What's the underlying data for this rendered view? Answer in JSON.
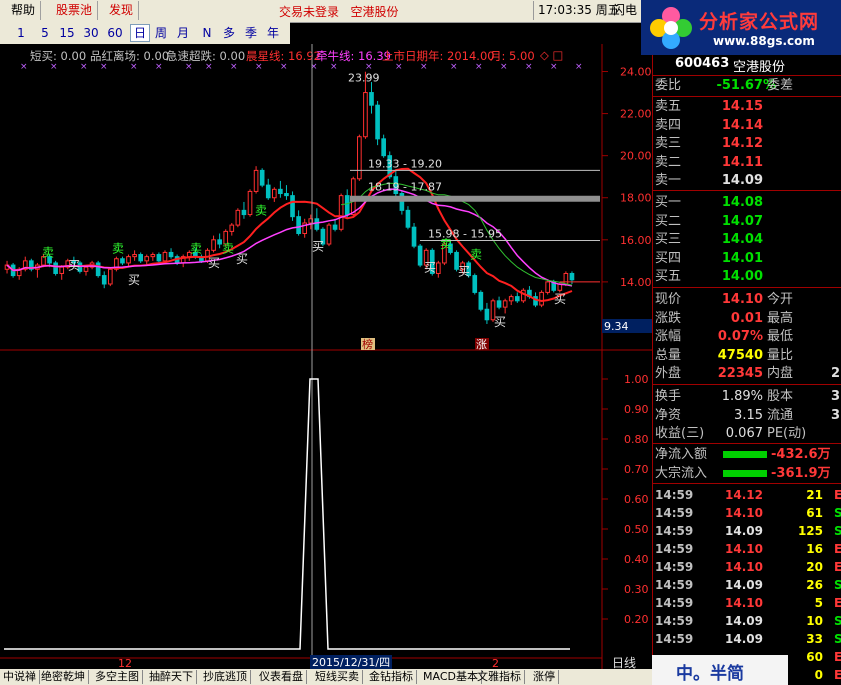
{
  "menu": {
    "help": "帮助",
    "pool": "股票池",
    "spot": "发现",
    "status": "交易未登录",
    "stock_name_top": "空港股份",
    "clock": "17:03:35",
    "weekday": "周五",
    "flash": "闪电"
  },
  "logo": {
    "title": "分析家公式网",
    "url": "www.88gs.com"
  },
  "periods": [
    "1",
    "5",
    "15",
    "30",
    "60",
    "日",
    "周",
    "月",
    "N",
    "多",
    "季",
    "年"
  ],
  "selected_period": "日",
  "legend": [
    {
      "text": "短买: 0.00",
      "color": "#c0c0c0"
    },
    {
      "text": "品红离场: 0.00",
      "color": "#c0c0c0"
    },
    {
      "text": "急速超跌: 0.00",
      "color": "#c0c0c0"
    },
    {
      "text": "晨星线: 16.92",
      "color": "#ff3030"
    },
    {
      "text": "牵牛线: 16.39",
      "color": "#ff40ff"
    },
    {
      "text": "上市日期年: 2014.00",
      "color": "#ff3030"
    },
    {
      "text": "月: 5.00",
      "color": "#ff3030"
    },
    {
      "text": "◇ □",
      "color": "#ff3030"
    }
  ],
  "price_axis": [
    "24.00",
    "22.00",
    "20.00",
    "18.00",
    "16.00",
    "14.00",
    "12.00"
  ],
  "price_axis_extra": "9.34",
  "indicator_axis": [
    "1.00",
    "0.90",
    "0.80",
    "0.70",
    "0.60",
    "0.50",
    "0.40",
    "0.30",
    "0.20"
  ],
  "annotations": {
    "high": "23.99",
    "range1": "19.33 - 19.20",
    "range2": "18.19 - 17.87",
    "range3": "15.98 - 15.95",
    "sell": "卖",
    "buy": "买",
    "tag_bang": "榜",
    "tag_zhang": "涨"
  },
  "time_axis": {
    "left": "12",
    "cursor": "2015/12/31/四",
    "right": "2",
    "mode": "日线"
  },
  "quote": {
    "code": "600463",
    "name": "空港股份",
    "webi_label": "委比",
    "webi": "-51.67%",
    "weicha_label": "委差",
    "asks": [
      {
        "label": "卖五",
        "price": "14.15"
      },
      {
        "label": "卖四",
        "price": "14.14"
      },
      {
        "label": "卖三",
        "price": "14.12"
      },
      {
        "label": "卖二",
        "price": "14.11"
      },
      {
        "label": "卖一",
        "price": "14.09"
      }
    ],
    "bids": [
      {
        "label": "买一",
        "price": "14.08"
      },
      {
        "label": "买二",
        "price": "14.07"
      },
      {
        "label": "买三",
        "price": "14.04"
      },
      {
        "label": "买四",
        "price": "14.01"
      },
      {
        "label": "买五",
        "price": "14.00"
      }
    ],
    "stats": [
      {
        "label": "现价",
        "value": "14.10",
        "color": "red",
        "label2": "今开"
      },
      {
        "label": "涨跌",
        "value": "0.01",
        "color": "red",
        "label2": "最高"
      },
      {
        "label": "涨幅",
        "value": "0.07%",
        "color": "red",
        "label2": "最低"
      },
      {
        "label": "总量",
        "value": "47540",
        "color": "yel",
        "label2": "量比"
      },
      {
        "label": "外盘",
        "value": "22345",
        "color": "red",
        "label2": "内盘",
        "extra": "2"
      }
    ],
    "stats2": [
      {
        "label": "换手",
        "value": "1.89%",
        "label2": "股本",
        "extra": "3"
      },
      {
        "label": "净资",
        "value": "3.15",
        "label2": "流通",
        "extra": "3"
      },
      {
        "label": "收益(三)",
        "value": "0.067",
        "label2": "PE(动)",
        "extra": ""
      }
    ],
    "flows": [
      {
        "label": "净流入额",
        "value": "-432.6万"
      },
      {
        "label": "大宗流入",
        "value": "-361.9万"
      }
    ],
    "ticks": [
      {
        "time": "14:59",
        "price": "14.12",
        "color": "red",
        "vol": "21",
        "side": "E"
      },
      {
        "time": "14:59",
        "price": "14.10",
        "color": "red",
        "vol": "61",
        "side": "S"
      },
      {
        "time": "14:59",
        "price": "14.09",
        "color": "wht",
        "vol": "125",
        "side": "S"
      },
      {
        "time": "14:59",
        "price": "14.10",
        "color": "red",
        "vol": "16",
        "side": "E"
      },
      {
        "time": "14:59",
        "price": "14.10",
        "color": "red",
        "vol": "20",
        "side": "E"
      },
      {
        "time": "14:59",
        "price": "14.09",
        "color": "wht",
        "vol": "26",
        "side": "S"
      },
      {
        "time": "14:59",
        "price": "14.10",
        "color": "red",
        "vol": "5",
        "side": "E"
      },
      {
        "time": "14:59",
        "price": "14.09",
        "color": "wht",
        "vol": "10",
        "side": "S"
      },
      {
        "time": "14:59",
        "price": "14.09",
        "color": "wht",
        "vol": "33",
        "side": "S"
      },
      {
        "time": "",
        "price": "",
        "color": "wht",
        "vol": "60",
        "side": "E"
      },
      {
        "time": "",
        "price": "",
        "color": "wht",
        "vol": "0",
        "side": "E"
      }
    ]
  },
  "bottom_tabs": [
    "中说禅",
    "绝密乾坤",
    "多空主图",
    "抽醉天下",
    "抄底逃顶",
    "仪表看盘",
    "短线买卖",
    "金钻指标",
    "MACD基本",
    "文雅指标",
    "涨停"
  ],
  "bottom_right": {
    "text": "中。半简"
  },
  "chart_data": {
    "type": "candlestick",
    "price_axis_range": [
      11.0,
      24.5
    ],
    "candles": [
      [
        14.6,
        15.0,
        14.4,
        14.8
      ],
      [
        14.8,
        14.9,
        14.2,
        14.3
      ],
      [
        14.3,
        14.7,
        14.1,
        14.6
      ],
      [
        14.6,
        15.2,
        14.5,
        15.0
      ],
      [
        15.0,
        15.1,
        14.5,
        14.6
      ],
      [
        14.6,
        14.9,
        14.2,
        14.8
      ],
      [
        14.8,
        15.3,
        14.7,
        15.2
      ],
      [
        15.2,
        15.3,
        14.7,
        14.9
      ],
      [
        14.9,
        15.0,
        14.3,
        14.4
      ],
      [
        14.4,
        14.8,
        14.1,
        14.7
      ],
      [
        14.7,
        15.1,
        14.6,
        15.0
      ],
      [
        15.0,
        15.2,
        14.8,
        14.9
      ],
      [
        14.9,
        15.0,
        14.4,
        14.5
      ],
      [
        14.5,
        14.8,
        14.3,
        14.7
      ],
      [
        14.7,
        15.0,
        14.6,
        14.9
      ],
      [
        14.9,
        15.0,
        14.2,
        14.3
      ],
      [
        14.3,
        14.5,
        13.7,
        13.9
      ],
      [
        13.9,
        14.7,
        13.8,
        14.6
      ],
      [
        14.6,
        15.2,
        14.5,
        15.1
      ],
      [
        15.1,
        15.2,
        14.8,
        14.9
      ],
      [
        14.9,
        15.3,
        14.7,
        15.2
      ],
      [
        15.2,
        15.5,
        15.0,
        15.3
      ],
      [
        15.3,
        15.4,
        14.9,
        15.0
      ],
      [
        15.0,
        15.3,
        14.8,
        15.2
      ],
      [
        15.2,
        15.4,
        15.0,
        15.3
      ],
      [
        15.3,
        15.4,
        14.9,
        15.0
      ],
      [
        15.0,
        15.5,
        14.9,
        15.4
      ],
      [
        15.4,
        15.6,
        15.1,
        15.2
      ],
      [
        15.2,
        15.3,
        14.8,
        14.9
      ],
      [
        14.9,
        15.3,
        14.7,
        15.2
      ],
      [
        15.2,
        15.5,
        15.0,
        15.4
      ],
      [
        15.4,
        15.6,
        15.1,
        15.2
      ],
      [
        15.2,
        15.3,
        14.9,
        15.0
      ],
      [
        15.0,
        15.6,
        14.9,
        15.5
      ],
      [
        15.5,
        16.2,
        15.4,
        16.0
      ],
      [
        16.0,
        16.3,
        15.6,
        15.8
      ],
      [
        15.8,
        16.5,
        15.7,
        16.4
      ],
      [
        16.4,
        16.8,
        16.2,
        16.7
      ],
      [
        16.7,
        17.5,
        16.6,
        17.4
      ],
      [
        17.4,
        17.8,
        17.0,
        17.2
      ],
      [
        17.2,
        18.4,
        17.1,
        18.3
      ],
      [
        18.3,
        19.5,
        18.2,
        19.3
      ],
      [
        19.3,
        19.4,
        18.5,
        18.6
      ],
      [
        18.6,
        18.9,
        17.9,
        18.0
      ],
      [
        18.0,
        18.5,
        17.8,
        18.4
      ],
      [
        18.4,
        18.8,
        18.0,
        18.2
      ],
      [
        18.2,
        18.6,
        17.9,
        18.1
      ],
      [
        18.1,
        18.3,
        16.9,
        17.1
      ],
      [
        17.1,
        17.4,
        16.2,
        16.3
      ],
      [
        16.3,
        17.0,
        16.1,
        16.8
      ],
      [
        16.8,
        17.2,
        16.5,
        17.0
      ],
      [
        17.0,
        17.5,
        16.4,
        16.5
      ],
      [
        16.5,
        16.6,
        15.7,
        15.8
      ],
      [
        15.8,
        16.8,
        15.7,
        16.7
      ],
      [
        16.7,
        17.0,
        16.4,
        16.5
      ],
      [
        16.5,
        18.2,
        16.4,
        18.1
      ],
      [
        18.1,
        18.4,
        17.0,
        17.2
      ],
      [
        17.2,
        19.0,
        17.1,
        18.9
      ],
      [
        18.9,
        21.0,
        18.8,
        20.9
      ],
      [
        20.9,
        23.99,
        20.8,
        23.0
      ],
      [
        23.0,
        23.5,
        22.0,
        22.4
      ],
      [
        22.4,
        22.6,
        20.5,
        20.8
      ],
      [
        20.8,
        21.0,
        19.9,
        20.0
      ],
      [
        20.0,
        20.2,
        18.9,
        19.0
      ],
      [
        19.0,
        19.3,
        17.9,
        18.2
      ],
      [
        18.2,
        18.3,
        17.2,
        17.4
      ],
      [
        17.4,
        17.6,
        16.5,
        16.6
      ],
      [
        16.6,
        16.8,
        15.6,
        15.7
      ],
      [
        15.7,
        15.8,
        14.7,
        14.8
      ],
      [
        14.8,
        15.6,
        14.6,
        15.5
      ],
      [
        15.5,
        15.6,
        14.3,
        14.4
      ],
      [
        14.4,
        15.0,
        14.2,
        14.9
      ],
      [
        14.9,
        15.9,
        14.8,
        15.8
      ],
      [
        15.8,
        16.0,
        15.3,
        15.4
      ],
      [
        15.4,
        15.5,
        14.5,
        14.6
      ],
      [
        14.6,
        15.0,
        14.4,
        14.9
      ],
      [
        14.9,
        15.0,
        14.2,
        14.3
      ],
      [
        14.3,
        14.4,
        13.4,
        13.5
      ],
      [
        13.5,
        13.6,
        12.6,
        12.7
      ],
      [
        12.7,
        13.0,
        12.0,
        12.2
      ],
      [
        12.2,
        13.2,
        12.1,
        13.1
      ],
      [
        13.1,
        13.3,
        12.7,
        12.8
      ],
      [
        12.8,
        13.2,
        12.5,
        13.1
      ],
      [
        13.1,
        13.4,
        12.9,
        13.3
      ],
      [
        13.3,
        13.5,
        13.0,
        13.1
      ],
      [
        13.1,
        13.7,
        13.0,
        13.6
      ],
      [
        13.6,
        13.8,
        13.2,
        13.3
      ],
      [
        13.3,
        13.5,
        12.8,
        12.9
      ],
      [
        12.9,
        13.6,
        12.8,
        13.5
      ],
      [
        13.5,
        14.1,
        13.4,
        14.0
      ],
      [
        14.0,
        14.1,
        13.5,
        13.6
      ],
      [
        13.6,
        14.0,
        13.5,
        13.9
      ],
      [
        13.9,
        14.5,
        13.8,
        14.4
      ],
      [
        14.4,
        14.5,
        13.9,
        14.1
      ]
    ],
    "indicator_peak": 1.0,
    "indicator_range": [
      0.1,
      1.05
    ]
  }
}
